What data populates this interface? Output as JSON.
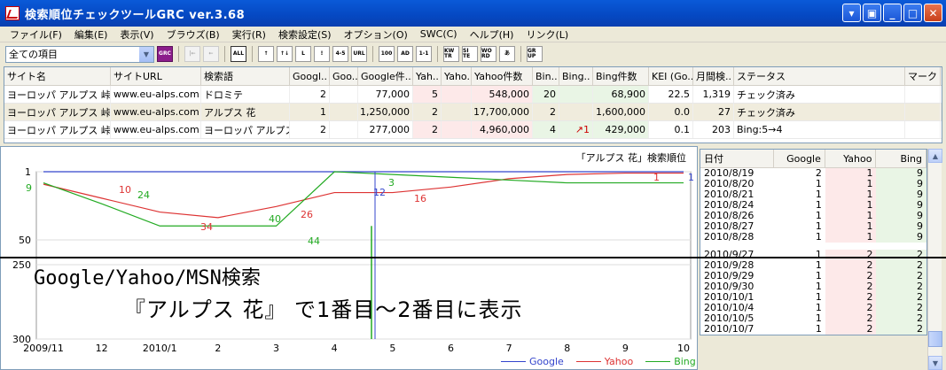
{
  "window": {
    "title": "検索順位チェックツールGRC  ver.3.68"
  },
  "menu": [
    "ファイル(F)",
    "編集(E)",
    "表示(V)",
    "ブラウズ(B)",
    "実行(R)",
    "検索設定(S)",
    "オプション(O)",
    "SWC(C)",
    "ヘルプ(H)",
    "リンク(L)"
  ],
  "toolbar": {
    "filter_value": "全ての項目",
    "buttons": [
      "GRC",
      "|←",
      "←",
      "ALL",
      "↑",
      "↑↓",
      "L",
      "!",
      "4-5",
      "URL",
      "100",
      "AD",
      "1-1",
      "KW TR",
      "SI TE",
      "WO RD",
      "あ",
      "GR UP"
    ]
  },
  "grid": {
    "columns": [
      "サイト名",
      "サイトURL",
      "検索語",
      "Googl..",
      "Goo..",
      "Google件...",
      "Yah..",
      "Yaho..",
      "Yahoo件数",
      "Bin..",
      "Bing..",
      "Bing件数",
      "KEI (Go..",
      "月間検..",
      "ステータス",
      "マーク"
    ],
    "rows": [
      [
        "ヨーロッパ アルプス 峠ドラ",
        "www.eu-alps.com",
        "ドロミテ",
        "2",
        "",
        "77,000",
        "5",
        "",
        "548,000",
        "20",
        "",
        "68,900",
        "22.5",
        "1,319",
        "チェック済み",
        ""
      ],
      [
        "ヨーロッパ アルプス 峠ドラ",
        "www.eu-alps.com",
        "アルプス 花",
        "1",
        "",
        "1,250,000",
        "2",
        "",
        "17,700,000",
        "2",
        "",
        "1,600,000",
        "0.0",
        "27",
        "チェック済み",
        ""
      ],
      [
        "ヨーロッパ アルプス 峠ドラ",
        "www.eu-alps.com",
        "ヨーロッパ アルプス",
        "2",
        "",
        "277,000",
        "2",
        "",
        "4,960,000",
        "4",
        "↗1",
        "429,000",
        "0.1",
        "203",
        "Bing:5→4",
        ""
      ]
    ]
  },
  "chart": {
    "title": "「アルプス 花」検索順位",
    "y_ticks": [
      "1",
      "50",
      "250",
      "300"
    ],
    "x_ticks": [
      "2009/11",
      "12",
      "2010/1",
      "2",
      "3",
      "4",
      "5",
      "6",
      "7",
      "8",
      "9",
      "10"
    ],
    "labels": [
      "9",
      "10",
      "24",
      "34",
      "40",
      "26",
      "44",
      "12",
      "3",
      "16",
      "1",
      "1"
    ],
    "legend": [
      "Google",
      "Yahoo",
      "Bing"
    ],
    "colors": {
      "google": "#3344cc",
      "yahoo": "#dd3333",
      "bing": "#22aa22"
    }
  },
  "chart_data": {
    "type": "line",
    "title": "「アルプス 花」検索順位",
    "x": [
      "2009/11",
      "12",
      "2010/1",
      "2",
      "3",
      "4",
      "5",
      "6",
      "7",
      "8",
      "9",
      "10"
    ],
    "series": [
      {
        "name": "Google",
        "values": [
          1,
          1,
          1,
          1,
          1,
          1,
          1,
          1,
          1,
          1,
          1,
          1
        ]
      },
      {
        "name": "Yahoo",
        "values": [
          10,
          20,
          30,
          34,
          26,
          16,
          16,
          12,
          6,
          3,
          2,
          2
        ]
      },
      {
        "name": "Bing",
        "values": [
          9,
          24,
          40,
          40,
          40,
          1,
          3,
          5,
          7,
          9,
          9,
          9
        ]
      }
    ]
  },
  "overlay": {
    "line1": "Google/Yahoo/MSN検索",
    "line2": "『アルプス 花』 で1番目～2番目に表示"
  },
  "rank_table": {
    "columns": [
      "日付",
      "Google",
      "Yahoo",
      "Bing"
    ],
    "rows_top": [
      [
        "2010/8/19",
        "2",
        "1",
        "9"
      ],
      [
        "2010/8/20",
        "1",
        "1",
        "9"
      ],
      [
        "2010/8/21",
        "1",
        "1",
        "9"
      ],
      [
        "2010/8/24",
        "1",
        "1",
        "9"
      ],
      [
        "2010/8/26",
        "1",
        "1",
        "9"
      ],
      [
        "2010/8/27",
        "1",
        "1",
        "9"
      ],
      [
        "2010/8/28",
        "1",
        "1",
        "9"
      ]
    ],
    "rows_bottom": [
      [
        "2010/9/27",
        "1",
        "2",
        "2"
      ],
      [
        "2010/9/28",
        "1",
        "2",
        "2"
      ],
      [
        "2010/9/29",
        "1",
        "2",
        "2"
      ],
      [
        "2010/9/30",
        "1",
        "2",
        "2"
      ],
      [
        "2010/10/1",
        "1",
        "2",
        "2"
      ],
      [
        "2010/10/4",
        "1",
        "2",
        "2"
      ],
      [
        "2010/10/5",
        "1",
        "2",
        "2"
      ],
      [
        "2010/10/7",
        "1",
        "2",
        "2"
      ]
    ]
  }
}
